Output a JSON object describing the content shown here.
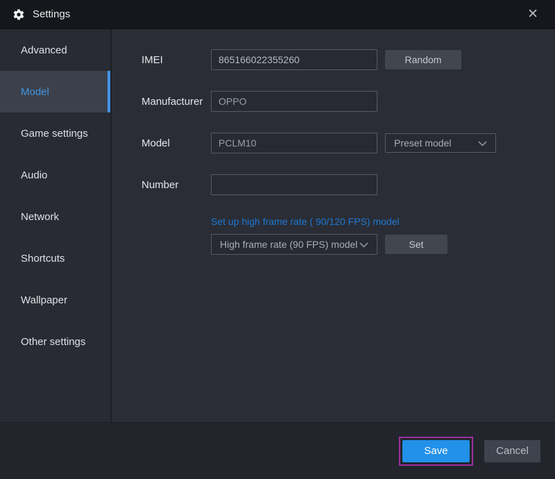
{
  "window": {
    "title": "Settings"
  },
  "icons": {
    "close": "✕"
  },
  "colors": {
    "accent_blue": "#2191ea",
    "sidebar_selected_blue": "#4094e4",
    "link_blue": "#1f78d3",
    "highlight_magenta": "#9e2f9e"
  },
  "sidebar": {
    "items": [
      {
        "label": "Advanced",
        "selected": false
      },
      {
        "label": "Model",
        "selected": true
      },
      {
        "label": "Game settings",
        "selected": false
      },
      {
        "label": "Audio",
        "selected": false
      },
      {
        "label": "Network",
        "selected": false
      },
      {
        "label": "Shortcuts",
        "selected": false
      },
      {
        "label": "Wallpaper",
        "selected": false
      },
      {
        "label": "Other settings",
        "selected": false
      }
    ]
  },
  "form": {
    "imei": {
      "label": "IMEI",
      "value": "865166022355260",
      "random_button": "Random"
    },
    "manufacturer": {
      "label": "Manufacturer",
      "value": "OPPO"
    },
    "model": {
      "label": "Model",
      "value": "PCLM10",
      "preset_dropdown": "Preset model"
    },
    "number": {
      "label": "Number",
      "value": ""
    },
    "hfr": {
      "caption": "Set up high frame rate ( 90/120 FPS) model",
      "dropdown": "High frame rate (90 FPS) model",
      "set_button": "Set"
    }
  },
  "footer": {
    "save": "Save",
    "cancel": "Cancel"
  }
}
